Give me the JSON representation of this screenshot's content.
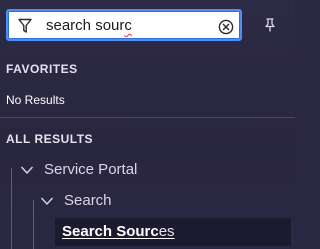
{
  "search": {
    "value_match": "search sour",
    "value_rest": "c",
    "clear_icon": "circle-x-icon",
    "filter_icon": "filter-funnel-icon",
    "pin_icon": "pin-icon"
  },
  "favorites": {
    "header": "FAVORITES",
    "empty_text": "No Results"
  },
  "all_results": {
    "header": "ALL RESULTS",
    "tree": [
      {
        "label": "Service Portal",
        "expanded": true
      },
      {
        "label": "Search",
        "expanded": true
      },
      {
        "label_match": "Search Sourc",
        "label_rest": "es",
        "selected": true
      }
    ]
  },
  "colors": {
    "panel_bg": "#2a2743",
    "focus_border": "#4f8ff0",
    "selected_bg": "#1c1a2f",
    "spell_underline": "#e0362c"
  }
}
